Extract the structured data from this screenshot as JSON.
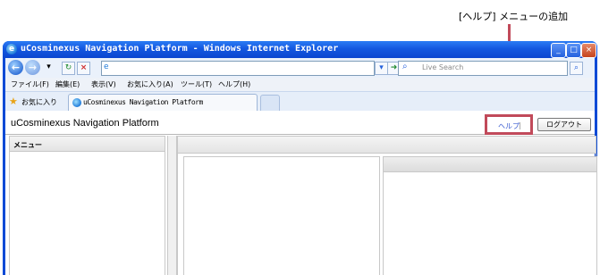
{
  "annotation": {
    "text": "[ヘルプ] メニューの追加"
  },
  "window": {
    "title": "uCosminexus Navigation Platform - Windows Internet Explorer",
    "controls": [
      "_",
      "□",
      "×"
    ]
  },
  "address_bar": {
    "search_placeholder": "Live Search"
  },
  "menu_bar": {
    "items": [
      "ファイル(F)",
      "編集(E)",
      "表示(V)",
      "お気に入り(A)",
      "ツール(T)",
      "ヘルプ(H)"
    ]
  },
  "favorites_bar": {
    "favorites_label": "お気に入り",
    "tab_title": "uCosminexus Navigation Platform"
  },
  "app": {
    "title": "uCosminexus Navigation Platform",
    "help_link": "ヘルプ",
    "separator": "|",
    "logout_button": "ログアウト",
    "left_panel_title": "メニュー"
  },
  "colors": {
    "callout": "#c14a5a",
    "title_bar": "#1458e0",
    "link": "#3a5bd0"
  }
}
